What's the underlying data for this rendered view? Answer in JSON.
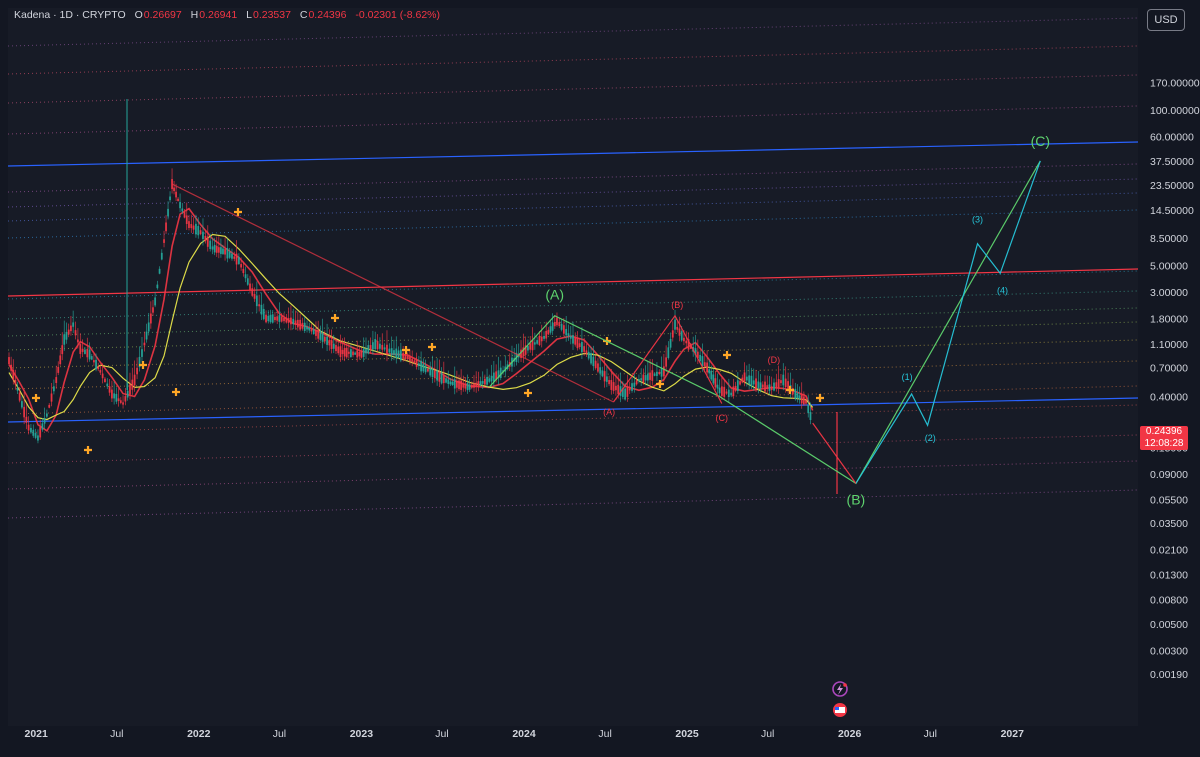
{
  "header": {
    "symbol": "Kadena · 1D · CRYPTO",
    "open_label": "O",
    "open": "0.26697",
    "high_label": "H",
    "high": "0.26941",
    "low_label": "L",
    "low": "0.23537",
    "close_label": "C",
    "close": "0.24396",
    "change": "-0.02301 (-8.62%)"
  },
  "currency_button": "USD",
  "last_price": {
    "value": "0.24396",
    "countdown": "12:08:28"
  },
  "colors": {
    "background": "#131722",
    "plot_background": "#171b26",
    "bearish": "#f23645",
    "bullish": "#26a69a",
    "channel": "#2962ff",
    "ema_long": "#e8e64a",
    "wave_green": "#5ed46e",
    "wave_cyan": "#26c6da",
    "wave_red": "#f23645"
  },
  "chart_data": {
    "type": "line",
    "title": "Kadena · 1D · CRYPTO",
    "y_scale": "log",
    "y_ticks": [
      "170.00000",
      "100.00000",
      "60.00000",
      "37.50000",
      "23.50000",
      "14.50000",
      "8.50000",
      "5.00000",
      "3.00000",
      "1.80000",
      "1.10000",
      "0.70000",
      "0.40000",
      "0.15000",
      "0.09000",
      "0.05500",
      "0.03500",
      "0.02100",
      "0.01300",
      "0.00800",
      "0.00500",
      "0.00300",
      "0.00190"
    ],
    "x_ticks": [
      "2021",
      "Jul",
      "2022",
      "Jul",
      "2023",
      "Jul",
      "2024",
      "Jul",
      "2025",
      "Jul",
      "2026",
      "Jul",
      "2027"
    ],
    "x_range": [
      "2020-11-01",
      "2027-06-01"
    ],
    "grid": false,
    "series": [
      {
        "values": [
          {
            "x": "2020-11-01",
            "y": 0.8
          },
          {
            "x": "2020-11-25",
            "y": 0.4
          },
          {
            "x": "2020-12-15",
            "y": 0.22
          },
          {
            "x": "2021-01-05",
            "y": 0.18
          },
          {
            "x": "2021-01-25",
            "y": 0.28
          },
          {
            "x": "2021-02-15",
            "y": 0.55
          },
          {
            "x": "2021-03-05",
            "y": 1.2
          },
          {
            "x": "2021-03-25",
            "y": 1.6
          },
          {
            "x": "2021-04-10",
            "y": 1.0
          },
          {
            "x": "2021-05-01",
            "y": 0.9
          },
          {
            "x": "2021-05-25",
            "y": 0.65
          },
          {
            "x": "2021-06-20",
            "y": 0.42
          },
          {
            "x": "2021-07-15",
            "y": 0.35
          },
          {
            "x": "2021-08-10",
            "y": 0.55
          },
          {
            "x": "2021-09-01",
            "y": 1.1
          },
          {
            "x": "2021-09-25",
            "y": 2.5
          },
          {
            "x": "2021-10-15",
            "y": 8.0
          },
          {
            "x": "2021-11-02",
            "y": 24.0
          },
          {
            "x": "2021-11-20",
            "y": 16.0
          },
          {
            "x": "2021-12-10",
            "y": 11.0
          },
          {
            "x": "2022-01-05",
            "y": 9.5
          },
          {
            "x": "2022-02-01",
            "y": 7.0
          },
          {
            "x": "2022-03-01",
            "y": 6.5
          },
          {
            "x": "2022-04-01",
            "y": 5.5
          },
          {
            "x": "2022-05-01",
            "y": 3.0
          },
          {
            "x": "2022-06-01",
            "y": 1.8
          },
          {
            "x": "2022-07-01",
            "y": 1.8
          },
          {
            "x": "2022-08-01",
            "y": 1.7
          },
          {
            "x": "2022-09-01",
            "y": 1.5
          },
          {
            "x": "2022-10-01",
            "y": 1.3
          },
          {
            "x": "2022-11-15",
            "y": 0.95
          },
          {
            "x": "2023-01-01",
            "y": 0.9
          },
          {
            "x": "2023-02-01",
            "y": 1.1
          },
          {
            "x": "2023-03-10",
            "y": 0.95
          },
          {
            "x": "2023-04-15",
            "y": 0.85
          },
          {
            "x": "2023-05-20",
            "y": 0.7
          },
          {
            "x": "2023-06-20",
            "y": 0.6
          },
          {
            "x": "2023-07-20",
            "y": 0.52
          },
          {
            "x": "2023-09-01",
            "y": 0.48
          },
          {
            "x": "2023-10-15",
            "y": 0.55
          },
          {
            "x": "2023-11-15",
            "y": 0.65
          },
          {
            "x": "2023-12-15",
            "y": 0.85
          },
          {
            "x": "2024-01-15",
            "y": 1.05
          },
          {
            "x": "2024-02-15",
            "y": 1.25
          },
          {
            "x": "2024-03-15",
            "y": 1.7
          },
          {
            "x": "2024-04-15",
            "y": 1.25
          },
          {
            "x": "2024-05-15",
            "y": 1.0
          },
          {
            "x": "2024-06-15",
            "y": 0.7
          },
          {
            "x": "2024-07-15",
            "y": 0.5
          },
          {
            "x": "2024-08-15",
            "y": 0.42
          },
          {
            "x": "2024-09-15",
            "y": 0.55
          },
          {
            "x": "2024-10-15",
            "y": 0.6
          },
          {
            "x": "2024-11-10",
            "y": 0.65
          },
          {
            "x": "2024-12-05",
            "y": 1.6
          },
          {
            "x": "2024-12-25",
            "y": 1.2
          },
          {
            "x": "2025-01-20",
            "y": 0.95
          },
          {
            "x": "2025-02-15",
            "y": 0.7
          },
          {
            "x": "2025-03-15",
            "y": 0.45
          },
          {
            "x": "2025-04-10",
            "y": 0.42
          },
          {
            "x": "2025-05-10",
            "y": 0.58
          },
          {
            "x": "2025-06-10",
            "y": 0.5
          },
          {
            "x": "2025-07-10",
            "y": 0.47
          },
          {
            "x": "2025-08-05",
            "y": 0.55
          },
          {
            "x": "2025-09-01",
            "y": 0.42
          },
          {
            "x": "2025-09-25",
            "y": 0.36
          },
          {
            "x": "2025-10-10",
            "y": 0.24
          }
        ]
      }
    ],
    "annotations": {
      "green_waves": [
        {
          "label": "(A)",
          "x": "2024-03-10",
          "y": 2.6
        },
        {
          "label": "(B)",
          "x": "2026-01-15",
          "y": 0.05
        },
        {
          "label": "(C)",
          "x": "2027-03-05",
          "y": 50
        }
      ],
      "red_waves": [
        {
          "label": "(A)",
          "x": "2024-07-10",
          "y": 0.28
        },
        {
          "label": "(B)",
          "x": "2024-12-10",
          "y": 2.2
        },
        {
          "label": "(C)",
          "x": "2025-03-20",
          "y": 0.25
        },
        {
          "label": "(D)",
          "x": "2025-07-15",
          "y": 0.76
        }
      ],
      "cyan_waves": [
        {
          "label": "(1)",
          "x": "2026-05-10",
          "y": 0.55
        },
        {
          "label": "(2)",
          "x": "2026-07-01",
          "y": 0.17
        },
        {
          "label": "(3)",
          "x": "2026-10-15",
          "y": 11.5
        },
        {
          "label": "(4)",
          "x": "2026-12-10",
          "y": 2.9
        }
      ],
      "projections": [
        {
          "name": "green",
          "points": [
            {
              "x": "2025-03-15",
              "y": 0.4
            },
            {
              "x": "2026-01-15",
              "y": 0.075
            },
            {
              "x": "2027-03-05",
              "y": 37.5
            }
          ]
        },
        {
          "name": "cyan",
          "points": [
            {
              "x": "2026-01-15",
              "y": 0.075
            },
            {
              "x": "2026-05-20",
              "y": 0.42
            },
            {
              "x": "2026-06-25",
              "y": 0.23
            },
            {
              "x": "2026-10-15",
              "y": 7.6
            },
            {
              "x": "2026-12-05",
              "y": 4.3
            },
            {
              "x": "2027-03-05",
              "y": 37.5
            }
          ]
        },
        {
          "name": "red",
          "points": [
            {
              "x": "2025-10-10",
              "y": 0.24
            },
            {
              "x": "2026-01-15",
              "y": 0.075
            }
          ]
        },
        {
          "name": "green_A",
          "points": [
            {
              "x": "2023-10-15",
              "y": 0.48
            },
            {
              "x": "2024-03-10",
              "y": 1.9
            },
            {
              "x": "2025-03-15",
              "y": 0.4
            }
          ]
        },
        {
          "name": "red_B",
          "points": [
            {
              "x": "2024-07-20",
              "y": 0.36
            },
            {
              "x": "2024-12-05",
              "y": 1.9
            },
            {
              "x": "2025-03-20",
              "y": 0.35
            }
          ]
        },
        {
          "name": "red_big",
          "points": [
            {
              "x": "2021-11-02",
              "y": 24
            },
            {
              "x": "2024-07-20",
              "y": 0.36
            }
          ]
        }
      ]
    }
  }
}
